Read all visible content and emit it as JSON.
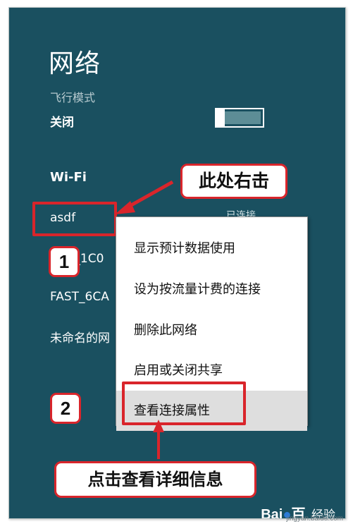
{
  "panel": {
    "title": "网络",
    "airplane_mode": {
      "label": "飞行模式",
      "state": "关闭"
    },
    "wifi_heading": "Wi-Fi",
    "networks": [
      {
        "name": "asdf",
        "status": "已连接"
      },
      {
        "name": "FAST_1C0",
        "visible_text": "T_1C0"
      },
      {
        "name": "FAST_6CA",
        "visible_text": "FAST_6CA"
      },
      {
        "name": "未命名的网",
        "visible_text": "未命名的网"
      }
    ]
  },
  "context_menu": {
    "items": [
      "显示预计数据使用",
      "设为按流量计费的连接",
      "删除此网络",
      "启用或关闭共享",
      "查看连接属性"
    ],
    "selected_index": 4
  },
  "annotations": {
    "step1": "1",
    "step2": "2",
    "callout_right_click": "此处右击",
    "callout_details": "点击查看详细信息"
  },
  "watermark": {
    "brand_prefix": "Bai",
    "brand_suffix": "百",
    "jingyan": "经验",
    "url": "jingyan.baidu.com"
  },
  "colors": {
    "panel_bg": "#1a5060",
    "accent_red": "#d9252b",
    "menu_selected": "#dedede"
  },
  "icons": {
    "arrow": "red-arrow",
    "baidu_paw": "paw-icon"
  }
}
